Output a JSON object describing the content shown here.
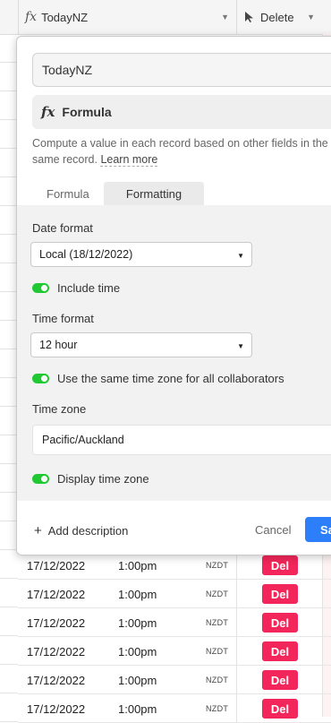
{
  "header": {
    "field_today_label": "TodayNZ",
    "field_delete_label": "Delete",
    "fx_symbol": "fx"
  },
  "popup": {
    "field_name_value": "TodayNZ",
    "field_type_label": "Formula",
    "description": "Compute a value in each record based on other fields in the same record.",
    "learn_more": "Learn more",
    "tabs": [
      {
        "label": "Formula",
        "active": false
      },
      {
        "label": "Formatting",
        "active": true
      }
    ],
    "date_format_label": "Date format",
    "date_format_value": "Local (18/12/2022)",
    "include_time_label": "Include time",
    "time_format_label": "Time format",
    "time_format_value": "12 hour",
    "same_tz_label": "Use the same time zone for all collaborators",
    "time_zone_label": "Time zone",
    "time_zone_value": "Pacific/Auckland",
    "display_tz_label": "Display time zone",
    "add_description": "Add description",
    "cancel": "Cancel",
    "save": "Sa"
  },
  "rows": [
    {
      "date": "17/12/2022",
      "time": "1:00pm",
      "tz": "NZDT",
      "action": "Del"
    },
    {
      "date": "17/12/2022",
      "time": "1:00pm",
      "tz": "NZDT",
      "action": "Del"
    },
    {
      "date": "17/12/2022",
      "time": "1:00pm",
      "tz": "NZDT",
      "action": "Del"
    },
    {
      "date": "17/12/2022",
      "time": "1:00pm",
      "tz": "NZDT",
      "action": "Del"
    },
    {
      "date": "17/12/2022",
      "time": "1:00pm",
      "tz": "NZDT",
      "action": "Del"
    },
    {
      "date": "17/12/2022",
      "time": "1:00pm",
      "tz": "NZDT",
      "action": "Del"
    }
  ],
  "colors": {
    "accent_blue": "#2d7ff9",
    "toggle_green": "#20c933",
    "delete_red": "#f2265a"
  }
}
